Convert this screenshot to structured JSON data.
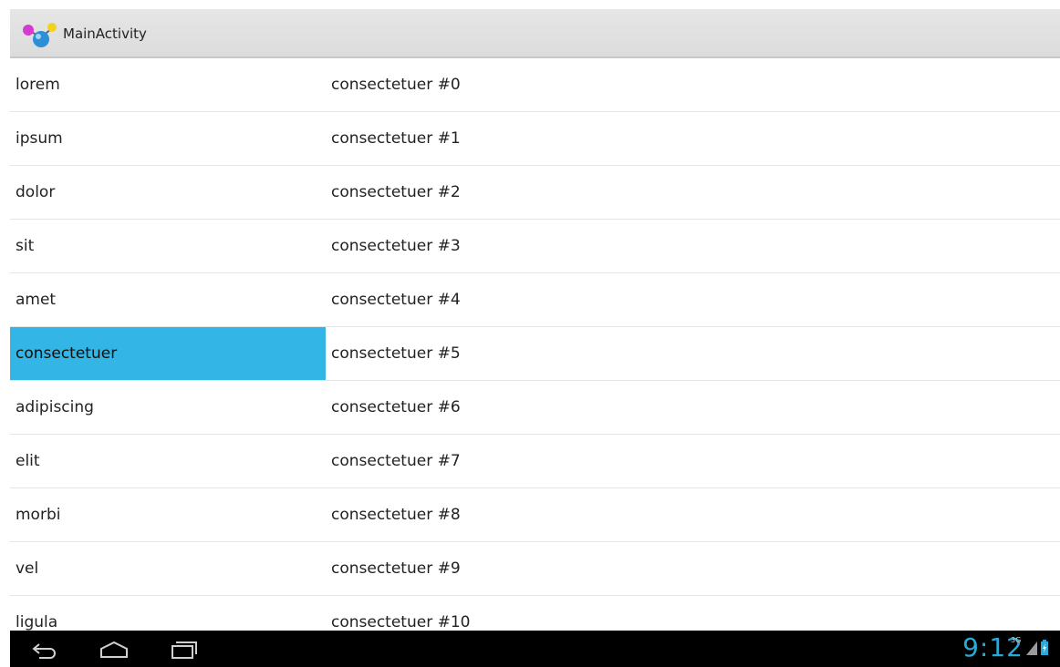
{
  "actionbar": {
    "title": "MainActivity",
    "icon": "molecule-app-icon"
  },
  "list": {
    "rows": [
      {
        "left": "lorem",
        "right": "consectetuer #0",
        "selected": false
      },
      {
        "left": "ipsum",
        "right": "consectetuer #1",
        "selected": false
      },
      {
        "left": "dolor",
        "right": "consectetuer #2",
        "selected": false
      },
      {
        "left": "sit",
        "right": "consectetuer #3",
        "selected": false
      },
      {
        "left": "amet",
        "right": "consectetuer #4",
        "selected": false
      },
      {
        "left": "consectetuer",
        "right": "consectetuer #5",
        "selected": true
      },
      {
        "left": "adipiscing",
        "right": "consectetuer #6",
        "selected": false
      },
      {
        "left": "elit",
        "right": "consectetuer #7",
        "selected": false
      },
      {
        "left": "morbi",
        "right": "consectetuer #8",
        "selected": false
      },
      {
        "left": "vel",
        "right": "consectetuer #9",
        "selected": false
      },
      {
        "left": "ligula",
        "right": "consectetuer #10",
        "selected": false
      }
    ],
    "selected_color": "#33b5e5"
  },
  "navbar": {
    "buttons": [
      "back-icon",
      "home-icon",
      "recent-apps-icon"
    ],
    "clock": "9:12",
    "network": "3G",
    "status_icons": [
      "signal-icon",
      "battery-charging-icon"
    ]
  }
}
